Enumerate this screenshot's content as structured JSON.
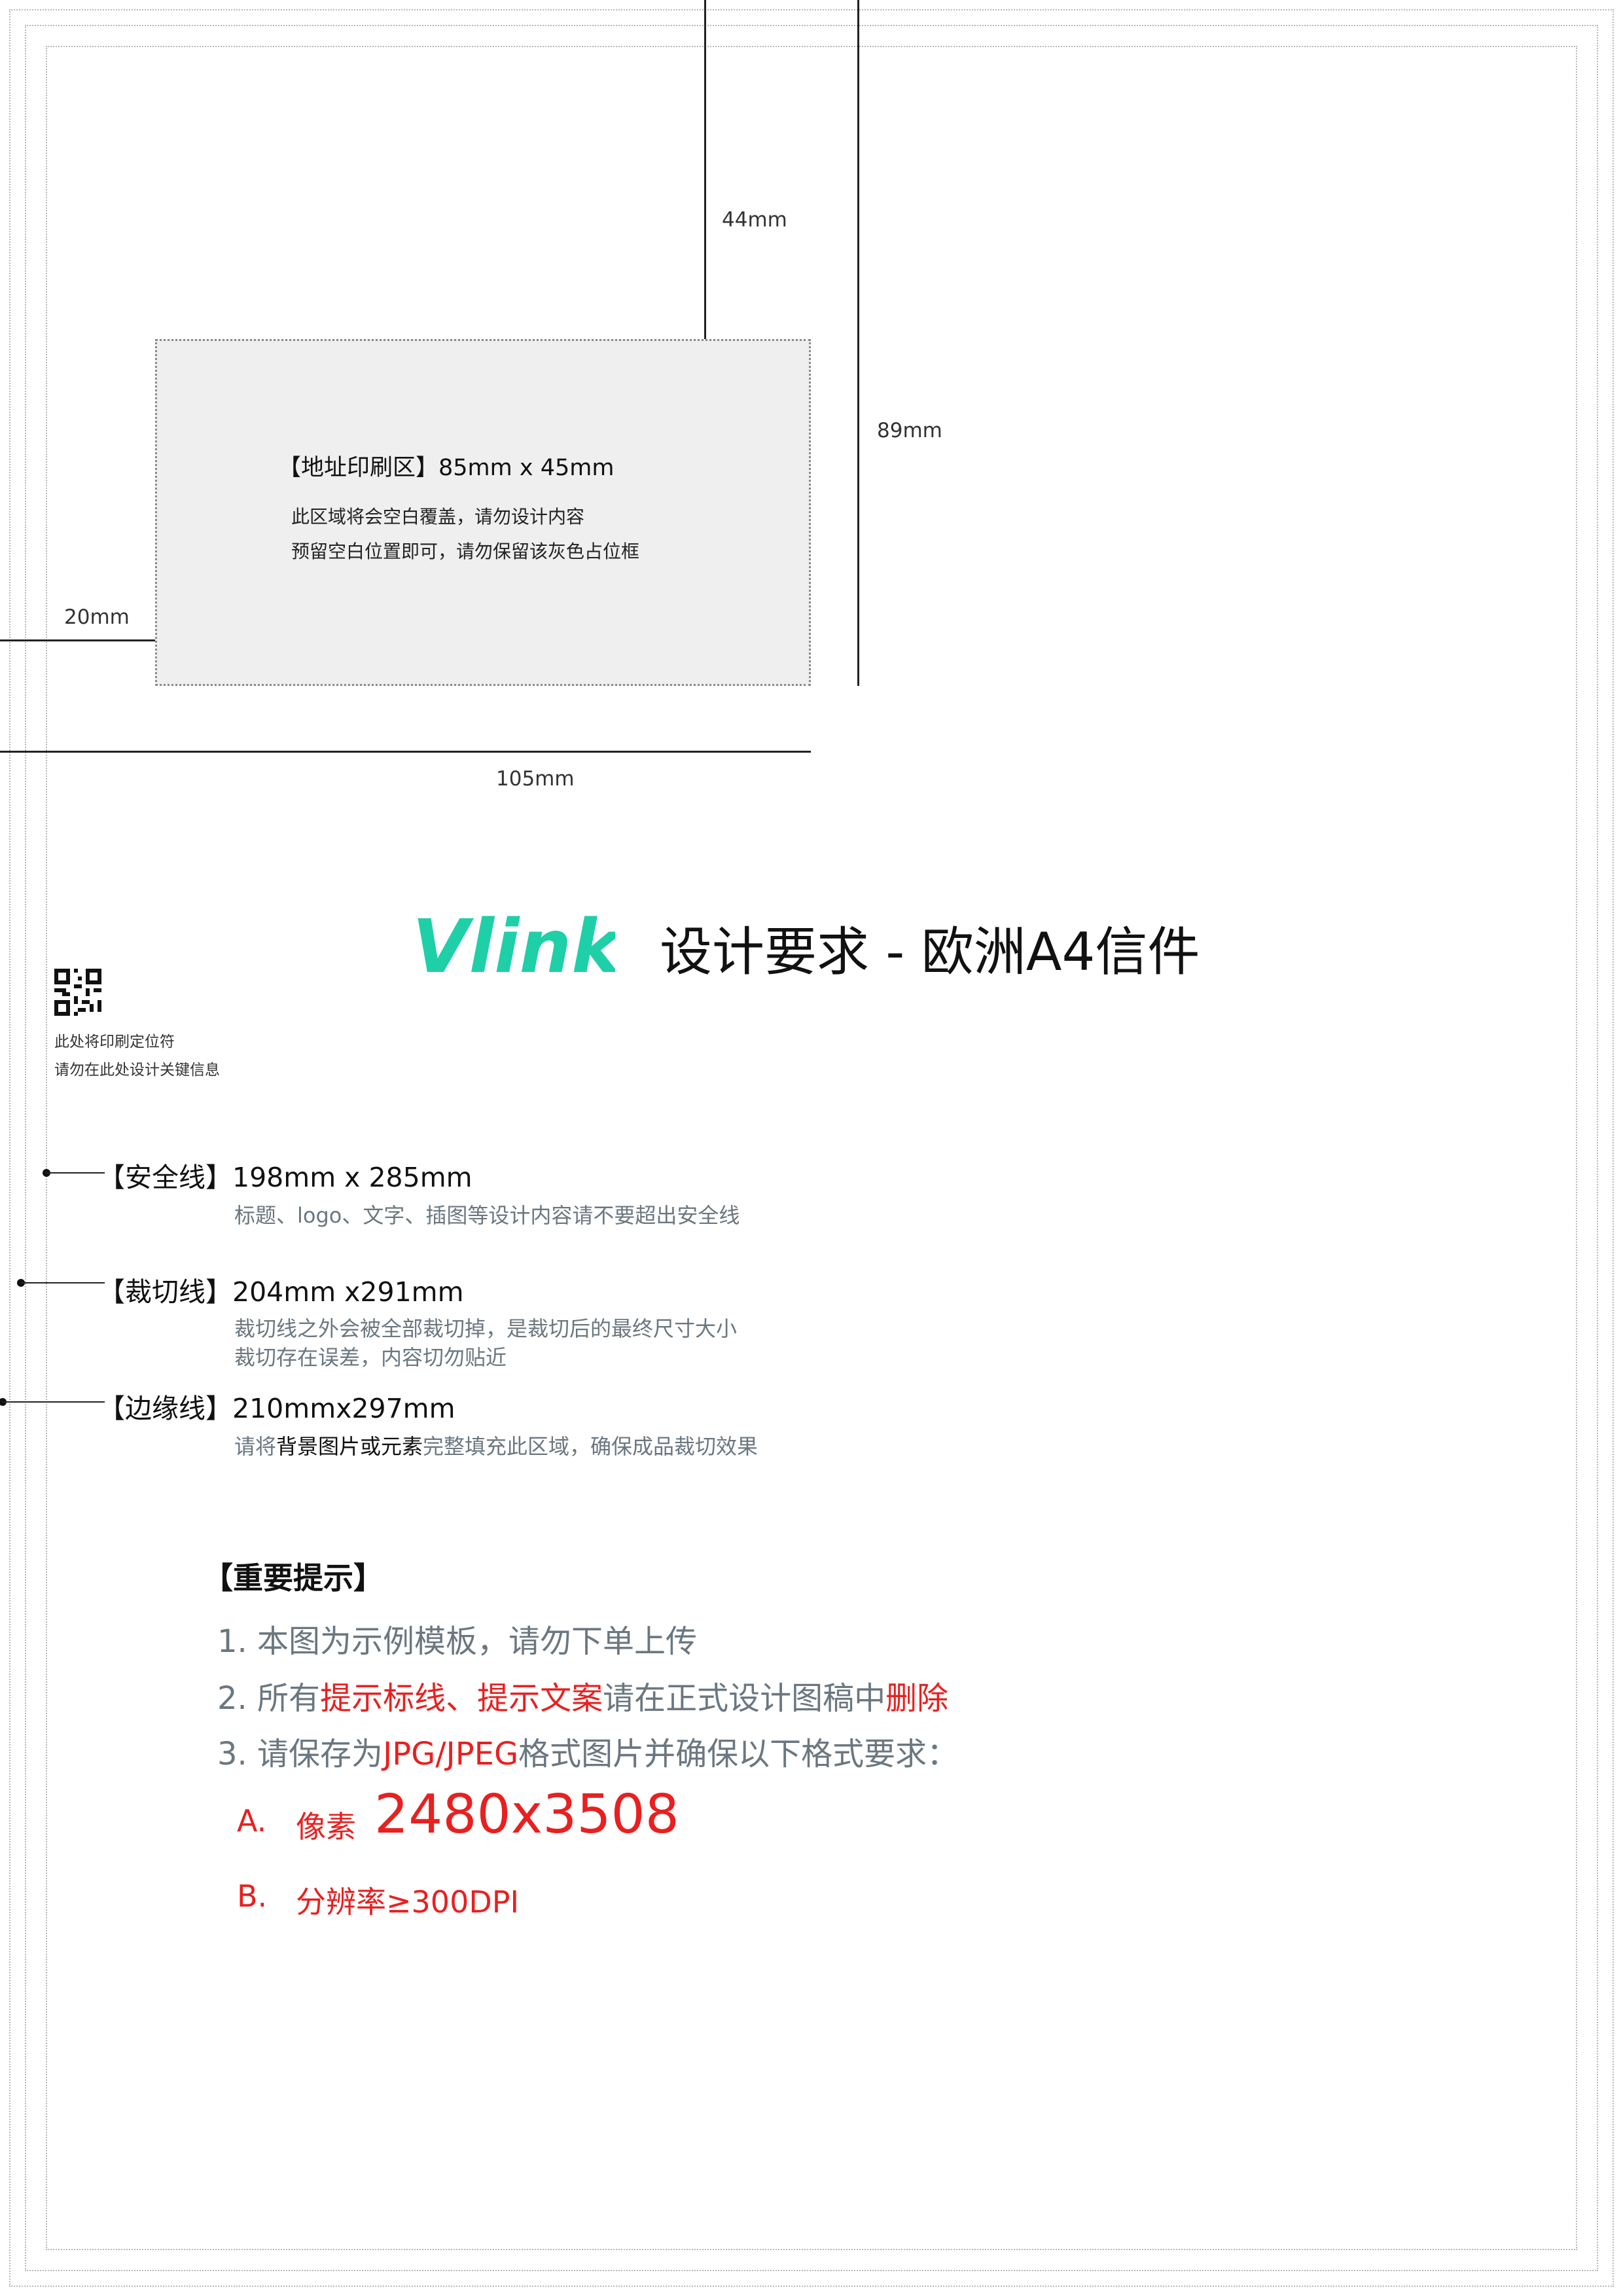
{
  "dimensions": {
    "top_gap": "44mm",
    "box_height_total": "89mm",
    "left_gap": "20mm",
    "box_width_total": "105mm"
  },
  "address_area": {
    "title": "【地址印刷区】85mm x 45mm",
    "desc_line1": "此区域将会空白覆盖，请勿设计内容",
    "desc_line2": "预留空白位置即可，请勿保留该灰色占位框"
  },
  "brand": {
    "logo_text": "Vlink",
    "logo_color": "#1fcfa8"
  },
  "page_title": "设计要求 - 欧洲A4信件",
  "qr_note": {
    "line1": "此处将印刷定位符",
    "line2": "请勿在此处设计关键信息"
  },
  "lines": {
    "safety": {
      "label": "【安全线】198mm x 285mm",
      "desc": "标题、logo、文字、插图等设计内容请不要超出安全线"
    },
    "cut": {
      "label": "【裁切线】204mm x291mm",
      "desc1": "裁切线之外会被全部裁切掉，是裁切后的最终尺寸大小",
      "desc2": "裁切存在误差，内容切勿贴近"
    },
    "edge": {
      "label": "【边缘线】210mmx297mm",
      "desc_a": "请将",
      "desc_b": "背景图片或元素",
      "desc_c": "完整填充此区域，确保成品裁切效果"
    }
  },
  "tips": {
    "title": "【重要提示】",
    "tip1": "1. 本图为示例模板，请勿下单上传",
    "tip2_a": "2. 所有",
    "tip2_b": "提示标线、提示文案",
    "tip2_c": "请在正式设计图稿中",
    "tip2_d": "删除",
    "tip3_a": "3. 请保存为",
    "tip3_b": "JPG/JPEG",
    "tip3_c": "格式图片并确保以下格式要求：",
    "req_a_label": "A.",
    "req_a_text": "像素",
    "req_a_value": "2480x3508",
    "req_b_label": "B.",
    "req_b_text": "分辨率≥300DPI"
  },
  "colors": {
    "accent_red": "#e82020",
    "muted_text": "#6b7780",
    "placeholder_gray": "#efefef"
  }
}
